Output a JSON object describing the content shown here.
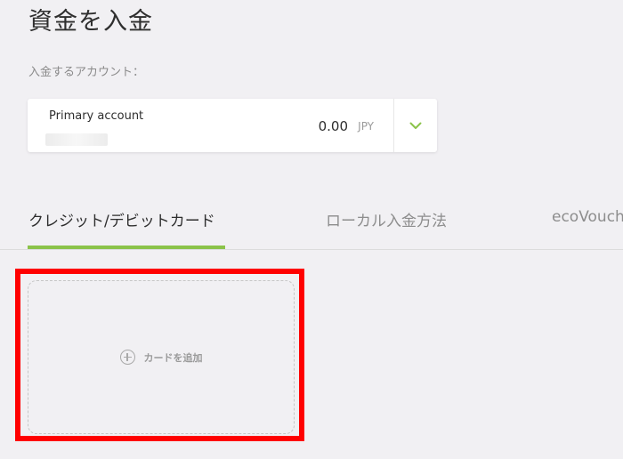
{
  "page": {
    "title": "資金を入金"
  },
  "account": {
    "label": "入金するアカウント：",
    "name": "Primary account",
    "balance": "0.00",
    "currency": "JPY"
  },
  "tabs": [
    {
      "label": "クレジット/デビットカード",
      "active": true
    },
    {
      "label": "ローカル入金方法",
      "active": false
    },
    {
      "label": "ecoVouch",
      "active": false
    }
  ],
  "add_card": {
    "label": "カードを追加"
  },
  "colors": {
    "background": "#f1f0f3",
    "accent": "#8bc34a",
    "highlight": "#ff0000"
  }
}
